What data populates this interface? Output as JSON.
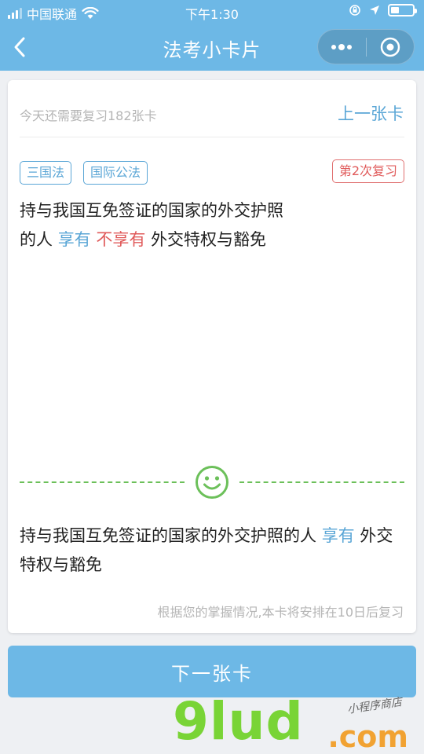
{
  "status_bar": {
    "carrier": "中国联通",
    "time": "下午1:30"
  },
  "nav": {
    "title": "法考小卡片"
  },
  "card": {
    "remaining_text": "今天还需要复习182张卡",
    "prev_label": "上一张卡",
    "tags": [
      "三国法",
      "国际公法"
    ],
    "review_badge": "第2次复习",
    "question": {
      "line1": "持与我国互免签证的国家的外交护照",
      "prefix": "的人",
      "opt1": "享有",
      "opt2": "不享有",
      "suffix": "外交特权与豁免"
    },
    "answer": {
      "text": "持与我国互免签证的国家的外交护照的人",
      "highlight": "享有",
      "suffix": "外交特权与豁免"
    },
    "schedule_text": "根据您的掌握情况,本卡将安排在10日后复习"
  },
  "next_button": "下一张卡",
  "watermark": {
    "brand": "9lud",
    "domain": ".com",
    "sub": "小程序商店"
  },
  "colors": {
    "primary": "#6db8e6",
    "accent_blue": "#5aa6d6",
    "accent_red": "#e05a5a",
    "success_green": "#6cc05a"
  }
}
